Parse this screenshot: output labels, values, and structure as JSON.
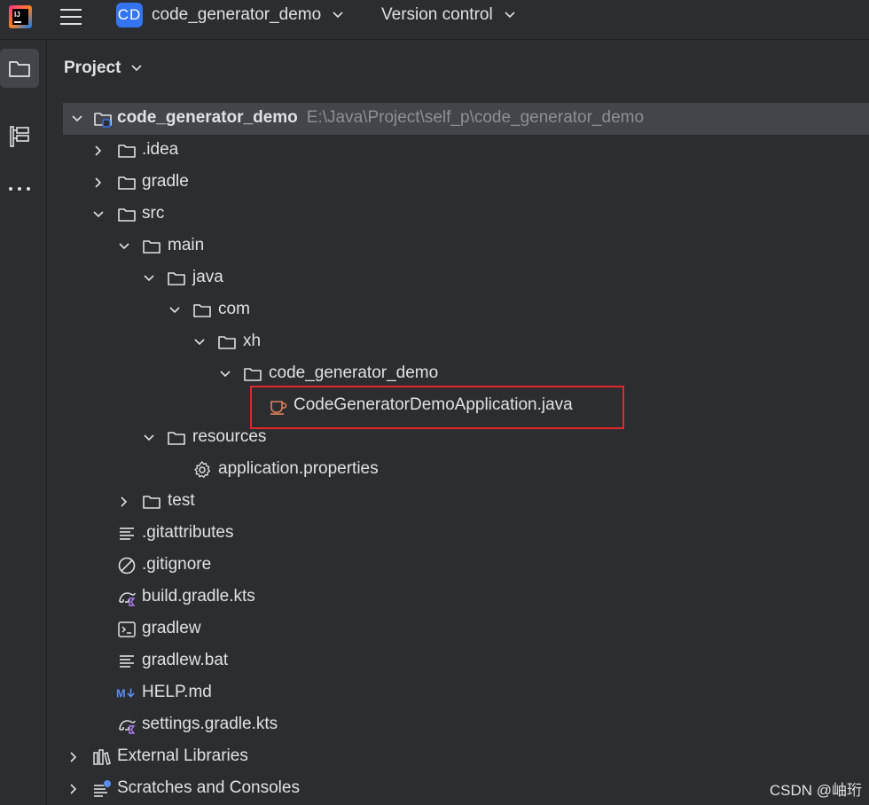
{
  "header": {
    "project_initials": "CD",
    "project_name": "code_generator_demo",
    "version_control_label": "Version control"
  },
  "toolstrip": {
    "items": [
      "project-tool",
      "structure-tool",
      "more-tools"
    ]
  },
  "panel": {
    "title": "Project"
  },
  "tree": {
    "root": {
      "name": "code_generator_demo",
      "path": "E:\\Java\\Project\\self_p\\code_generator_demo"
    },
    "idea": ".idea",
    "gradle": "gradle",
    "src": "src",
    "main": "main",
    "java": "java",
    "com": "com",
    "xh": "xh",
    "pkg": "code_generator_demo",
    "app_class": "CodeGeneratorDemoApplication.java",
    "resources": "resources",
    "app_props": "application.properties",
    "test": "test",
    "gitattributes": ".gitattributes",
    "gitignore": ".gitignore",
    "build_gradle": "build.gradle.kts",
    "gradlew": "gradlew",
    "gradlew_bat": "gradlew.bat",
    "help_md": "HELP.md",
    "settings_gradle": "settings.gradle.kts",
    "external_libraries": "External Libraries",
    "scratches": "Scratches and Consoles"
  },
  "watermark": "CSDN @岫珩",
  "colors": {
    "background": "#2b2d30",
    "selection": "#43454a",
    "accent": "#3574f0",
    "highlight_border": "#e3262c",
    "java_icon": "#e0825a"
  }
}
